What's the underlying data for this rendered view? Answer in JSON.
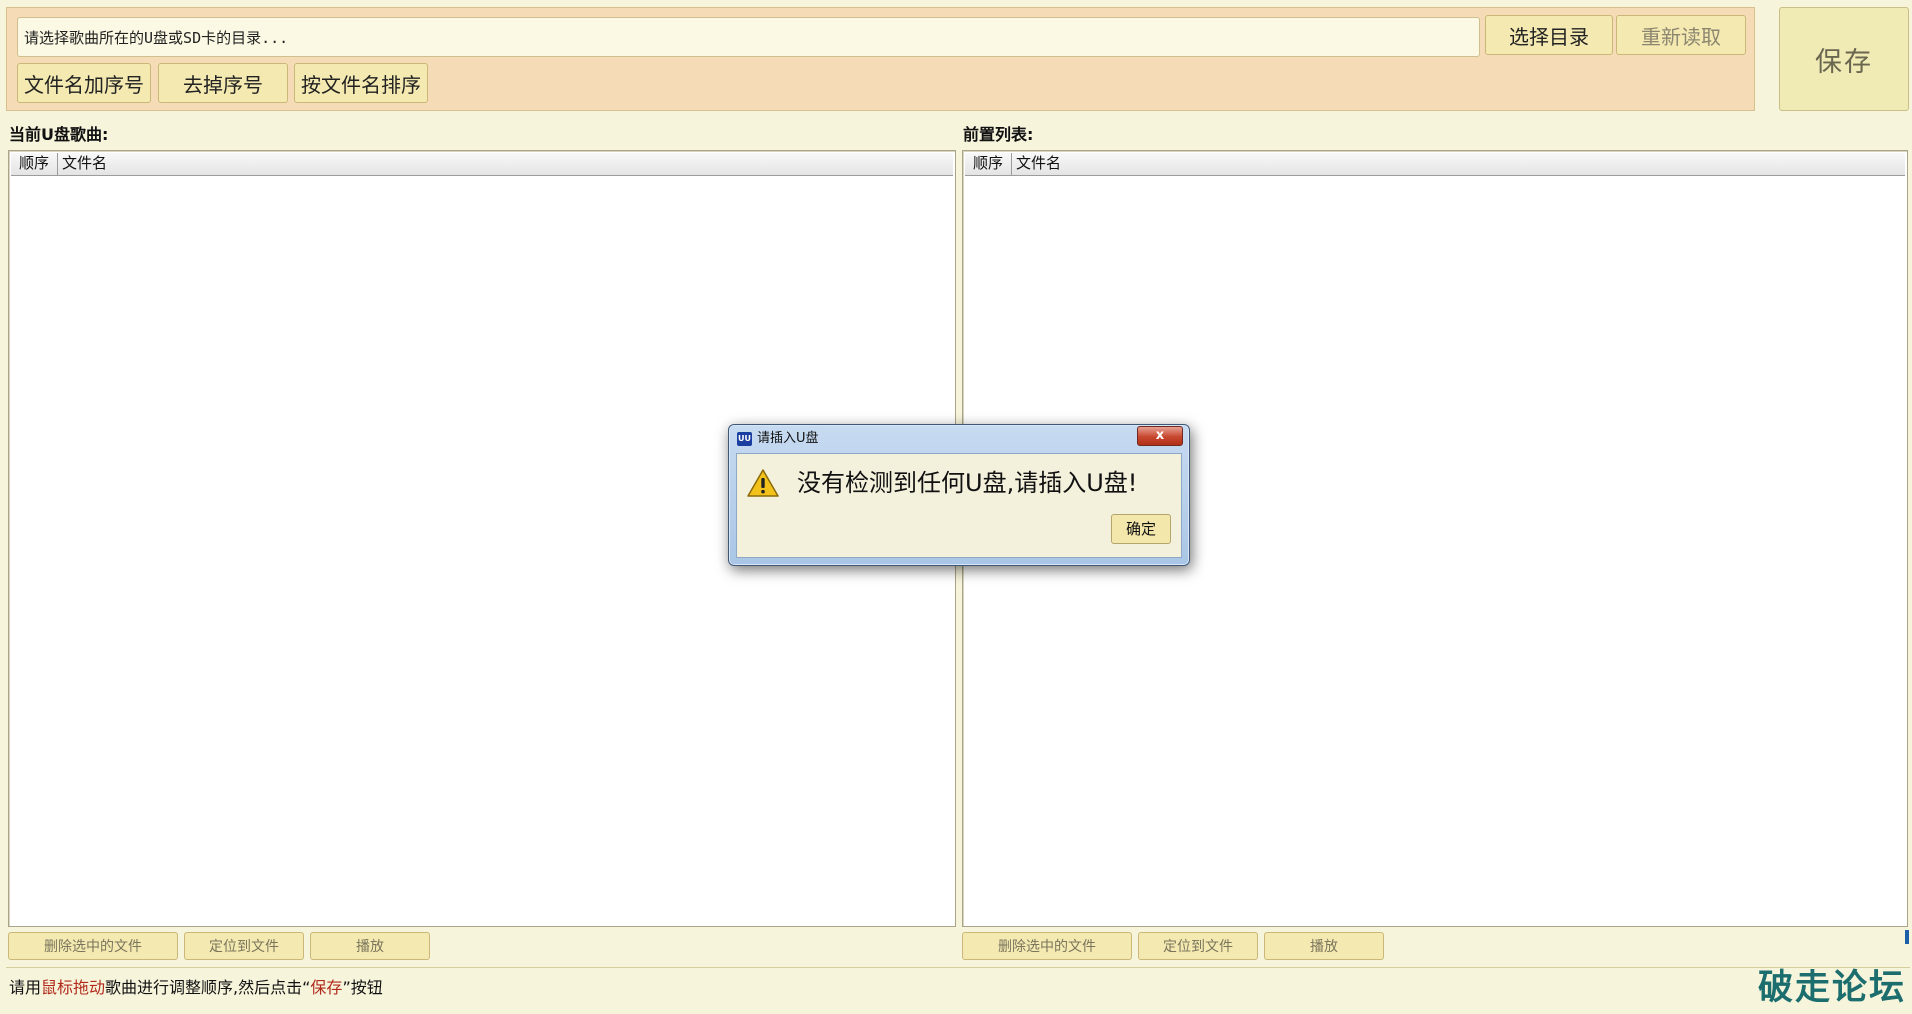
{
  "toolbar": {
    "dir_placeholder": "请选择歌曲所在的U盘或SD卡的目录...",
    "choose_dir_label": "选择目录",
    "reread_label": "重新读取",
    "add_prefix_label": "文件名加序号",
    "remove_prefix_label": "去掉序号",
    "sort_by_name_label": "按文件名排序",
    "save_label": "保存"
  },
  "left_panel": {
    "title": "当前U盘歌曲:",
    "columns": [
      "顺序",
      "文件名"
    ],
    "rows": [],
    "delete_label": "删除选中的文件",
    "locate_label": "定位到文件",
    "play_label": "播放"
  },
  "right_panel": {
    "title": "前置列表:",
    "columns": [
      "顺序",
      "文件名"
    ],
    "rows": [],
    "delete_label": "删除选中的文件",
    "locate_label": "定位到文件",
    "play_label": "播放"
  },
  "status": {
    "part1": "请用",
    "highlight1": "鼠标拖动",
    "part2": "歌曲进行调整顺序,然后点击“",
    "highlight2": "保存",
    "part3": "”按钮"
  },
  "watermark": "破走论坛",
  "dialog": {
    "app_icon": "UU",
    "title": "请插入U盘",
    "close_icon": "x",
    "icon": "warning-icon",
    "message": "没有检测到任何U盘,请插入U盘!",
    "ok_label": "确定"
  },
  "colors": {
    "toolbar_bg": "#f6dcb6",
    "window_bg": "#f7f4dc",
    "button_bg": "#f4eab1",
    "highlight": "#b12a1c",
    "watermark": "#1c6e6e"
  }
}
